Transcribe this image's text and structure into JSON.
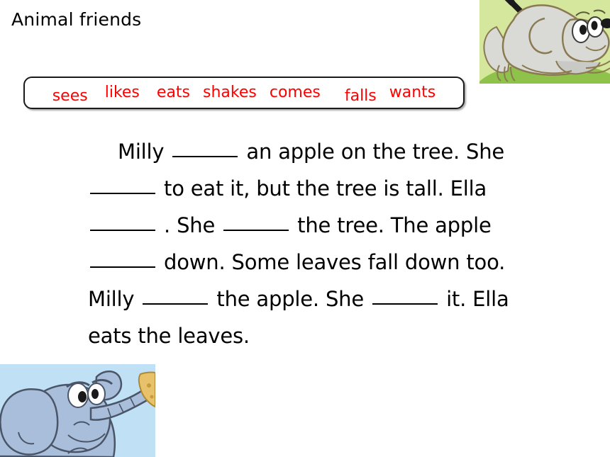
{
  "slide": {
    "title": "Animal friends",
    "background_color": "#ffffff"
  },
  "word_bank": {
    "border_color": "#1a1a1a",
    "word_color": "#ff0000",
    "words": [
      {
        "label": "sees"
      },
      {
        "label": "likes"
      },
      {
        "label": "eats"
      },
      {
        "label": "shakes"
      },
      {
        "label": "comes"
      },
      {
        "label": "falls"
      },
      {
        "label": "wants"
      }
    ]
  },
  "passage": {
    "lines": [
      {
        "text": "Milly ______ an apple on the tree. She"
      },
      {
        "text": "______ to eat it, but the tree is tall. Ella"
      },
      {
        "text": "______. She ______ the tree. The apple"
      },
      {
        "text": "______ down. Some leaves fall down too."
      },
      {
        "text": "Milly ______ the apple. She ______ it. Ella"
      },
      {
        "text": "eats the leaves."
      }
    ],
    "segments": [
      {
        "parts": [
          "Milly ",
          "BLANK",
          " an apple on the tree. She"
        ]
      },
      {
        "parts": [
          "BLANK",
          " to eat it, but the tree is tall. Ella"
        ]
      },
      {
        "parts": [
          "BLANK",
          ". She ",
          "BLANK",
          " the tree. The apple"
        ]
      },
      {
        "parts": [
          "BLANK",
          " down. Some leaves fall down too."
        ]
      },
      {
        "parts": [
          "Milly ",
          "BLANK",
          " the apple. She ",
          "BLANK",
          " it. Ella"
        ]
      },
      {
        "parts": [
          "eats the leaves."
        ]
      }
    ],
    "text_color": "#000000",
    "blank_count": 7
  },
  "images": {
    "mouse": {
      "name": "cartoon-mouse",
      "background_color": "#d5e79c",
      "ground_color": "#8fc24a",
      "body_color": "#d9dad6",
      "outline_color": "#8a7a52"
    },
    "elephant": {
      "name": "cartoon-elephant",
      "background_color": "#bfe0f5",
      "body_color": "#a8bedb",
      "outline_color": "#4a5568",
      "object_color": "#e8c26a"
    }
  }
}
